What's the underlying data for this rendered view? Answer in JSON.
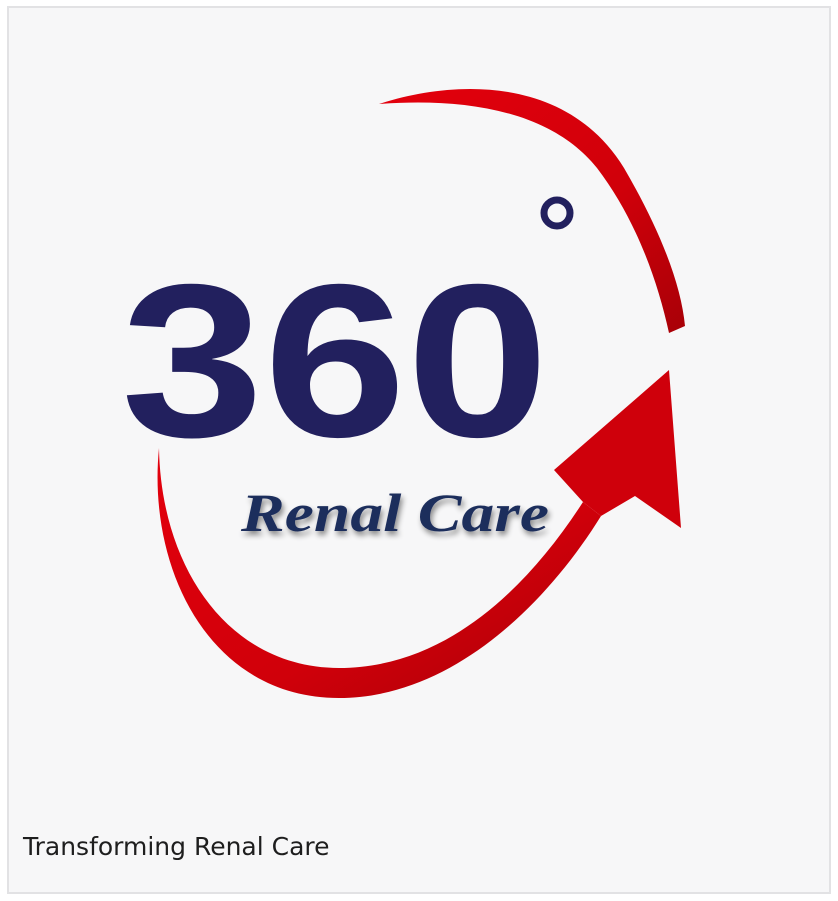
{
  "logo": {
    "number": "360",
    "degree_symbol": "°",
    "wordmark": "Renal Care",
    "colors": {
      "number": "#22205e",
      "wordmark": "#1d2d5c",
      "swoosh": "#d4000a",
      "swoosh_dark": "#a80007",
      "background": "#f7f7f8"
    }
  },
  "caption": {
    "text": "Transforming Renal Care"
  }
}
